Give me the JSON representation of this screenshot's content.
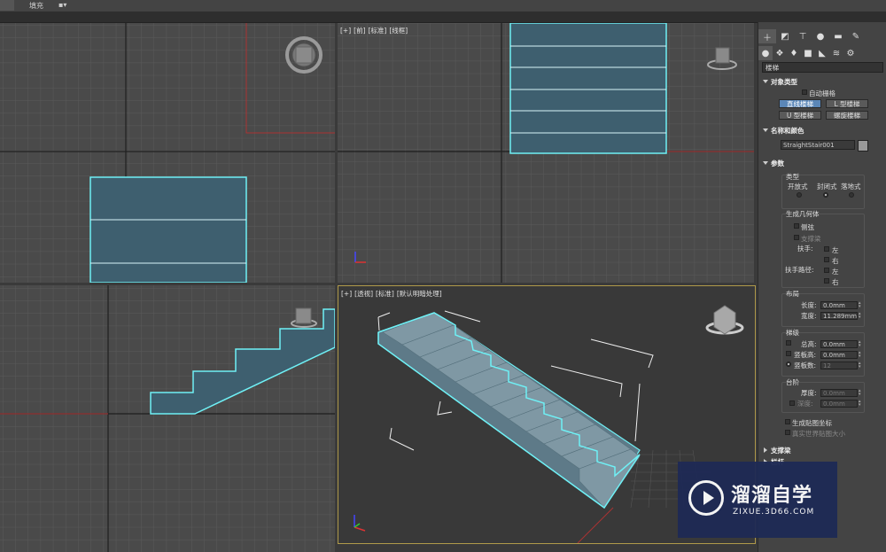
{
  "toolbar": {
    "fill_label": "填充",
    "dropdown": "▾"
  },
  "viewports": {
    "top_left": {
      "labels": []
    },
    "top_right": {
      "labels": [
        "[+]",
        "[前]",
        "[标准]",
        "[线框]"
      ]
    },
    "bottom_left": {
      "labels": []
    },
    "bottom_right": {
      "labels": [
        "[+]",
        "[透视]",
        "[标准]",
        "[默认明暗处理]"
      ]
    }
  },
  "panel": {
    "tab_icons": [
      "plus-icon",
      "modify-icon",
      "hierarchy-icon",
      "motion-icon",
      "display-icon",
      "utilities-icon"
    ],
    "subtab_icons": [
      "geometry-icon",
      "shapes-icon",
      "lights-icon",
      "cameras-icon",
      "helpers-icon",
      "spacewarps-icon",
      "systems-icon"
    ],
    "category": "楼梯",
    "object_type": {
      "title": "对象类型",
      "autogrid": "自动栅格",
      "buttons": [
        "直线楼梯",
        "L 型楼梯",
        "U 型楼梯",
        "螺旋楼梯"
      ]
    },
    "name_color": {
      "title": "名称和颜色",
      "name": "StraightStair001"
    },
    "params": {
      "title": "参数",
      "type_title": "类型",
      "types": [
        "开放式",
        "封闭式",
        "落地式"
      ],
      "gen_geom": "生成几何体",
      "side_strings": "侧弦",
      "support_beam": "支撑梁",
      "handrail": "扶手:",
      "handrail_path": "扶手路径:",
      "left": "左",
      "right": "右",
      "layout": "布局",
      "length_label": "长度:",
      "length_val": "0.0mm",
      "width_label": "宽度:",
      "width_val": "11.289mm",
      "stairs": "梯级",
      "total_height_label": "总高:",
      "total_height_val": "0.0mm",
      "riser_height_label": "竖板高:",
      "riser_height_val": "0.0mm",
      "riser_count_label": "竖板数:",
      "riser_count_val": "12",
      "steps": "台阶",
      "thickness_label": "厚度:",
      "thickness_val": "0.0mm",
      "depth_label": "深度:",
      "depth_val": "0.0mm",
      "gen_mapping": "生成贴图坐标",
      "real_world": "真实世界贴图大小"
    },
    "support_beam_roll": "支撑梁",
    "railings_roll": "栏杆"
  },
  "watermark": {
    "title": "溜溜自学",
    "subtitle": "ZIXUE.3D66.COM"
  }
}
